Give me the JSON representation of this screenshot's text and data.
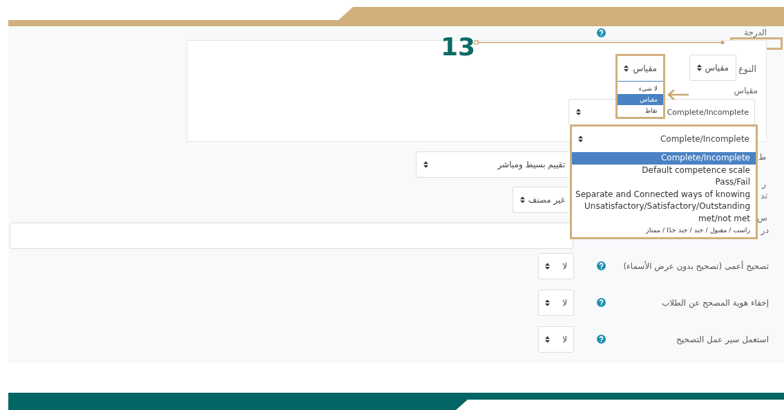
{
  "annotation": {
    "number": "13"
  },
  "grade": {
    "label": "الدرجة"
  },
  "type_field": {
    "label": "النوع",
    "value": "مقياس"
  },
  "type_dropdown": {
    "value": "مقياس",
    "options": [
      {
        "label": "لا شيء",
        "selected": false
      },
      {
        "label": "مقياس",
        "selected": true
      },
      {
        "label": "نقاط",
        "selected": false
      }
    ]
  },
  "scale_field": {
    "label": "مقياس",
    "value": "Complete/Incomplete"
  },
  "scale_dropdown": {
    "value": "Complete/Incomplete",
    "options": [
      {
        "label": "Complete/Incomplete",
        "selected": true
      },
      {
        "label": "Default competence scale",
        "selected": false
      },
      {
        "label": "Pass/Fail",
        "selected": false
      },
      {
        "label": "Separate and Connected ways of knowing",
        "selected": false
      },
      {
        "label": "Unsatisfactory/Satisfactory/Outstanding",
        "selected": false
      },
      {
        "label": "met/not met",
        "selected": false
      },
      {
        "label": "راسب / مقبول / جيد / جيد جدًا / ممتاز",
        "selected": false
      }
    ]
  },
  "partial_rows": [
    {
      "kind": "select",
      "labels": [
        "ط"
      ],
      "value": "تقييم بسيط ومباشر"
    },
    {
      "kind": "select",
      "labels": [
        "ر",
        "تد"
      ],
      "value": "غير مصنف"
    },
    {
      "kind": "input",
      "labels": [
        "س",
        "در"
      ]
    }
  ],
  "settings": [
    {
      "label": "تصحيح أعمى (تصحيح بدون عرض الأسماء)",
      "value": "لا"
    },
    {
      "label": "إخفاء هوية المصحح عن الطلاب",
      "value": "لا"
    },
    {
      "label": "استعمل سير عمل التصحيح",
      "value": "لا"
    }
  ]
}
